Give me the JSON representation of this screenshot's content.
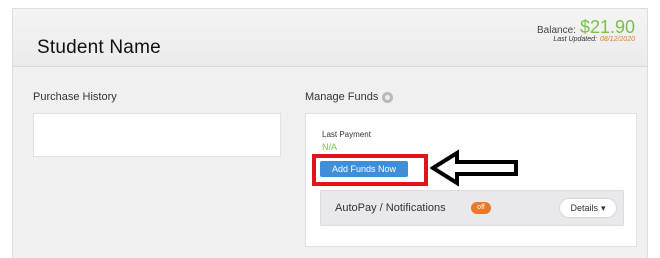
{
  "header": {
    "student_name": "Student Name",
    "balance_label": "Balance:",
    "balance_amount": "$21.90",
    "last_updated_label": "Last Updated:",
    "last_updated_date": "08/12/2020"
  },
  "purchase_history": {
    "title": "Purchase History"
  },
  "manage_funds": {
    "title": "Manage Funds",
    "title_icon": "settings-icon",
    "last_payment_label": "Last Payment",
    "last_payment_value": "N/A",
    "add_funds_label": "Add Funds Now",
    "autopay_label": "AutoPay / Notifications",
    "autopay_state": "off",
    "details_label": "Details",
    "details_icon": "chevron-down-icon"
  },
  "annotation": {
    "arrow_icon": "left-arrow-icon",
    "highlight_color": "#e3131b"
  },
  "colors": {
    "accent_green": "#7bbf4a",
    "button_blue": "#3f8fd8",
    "toggle_orange": "#e7782e"
  }
}
